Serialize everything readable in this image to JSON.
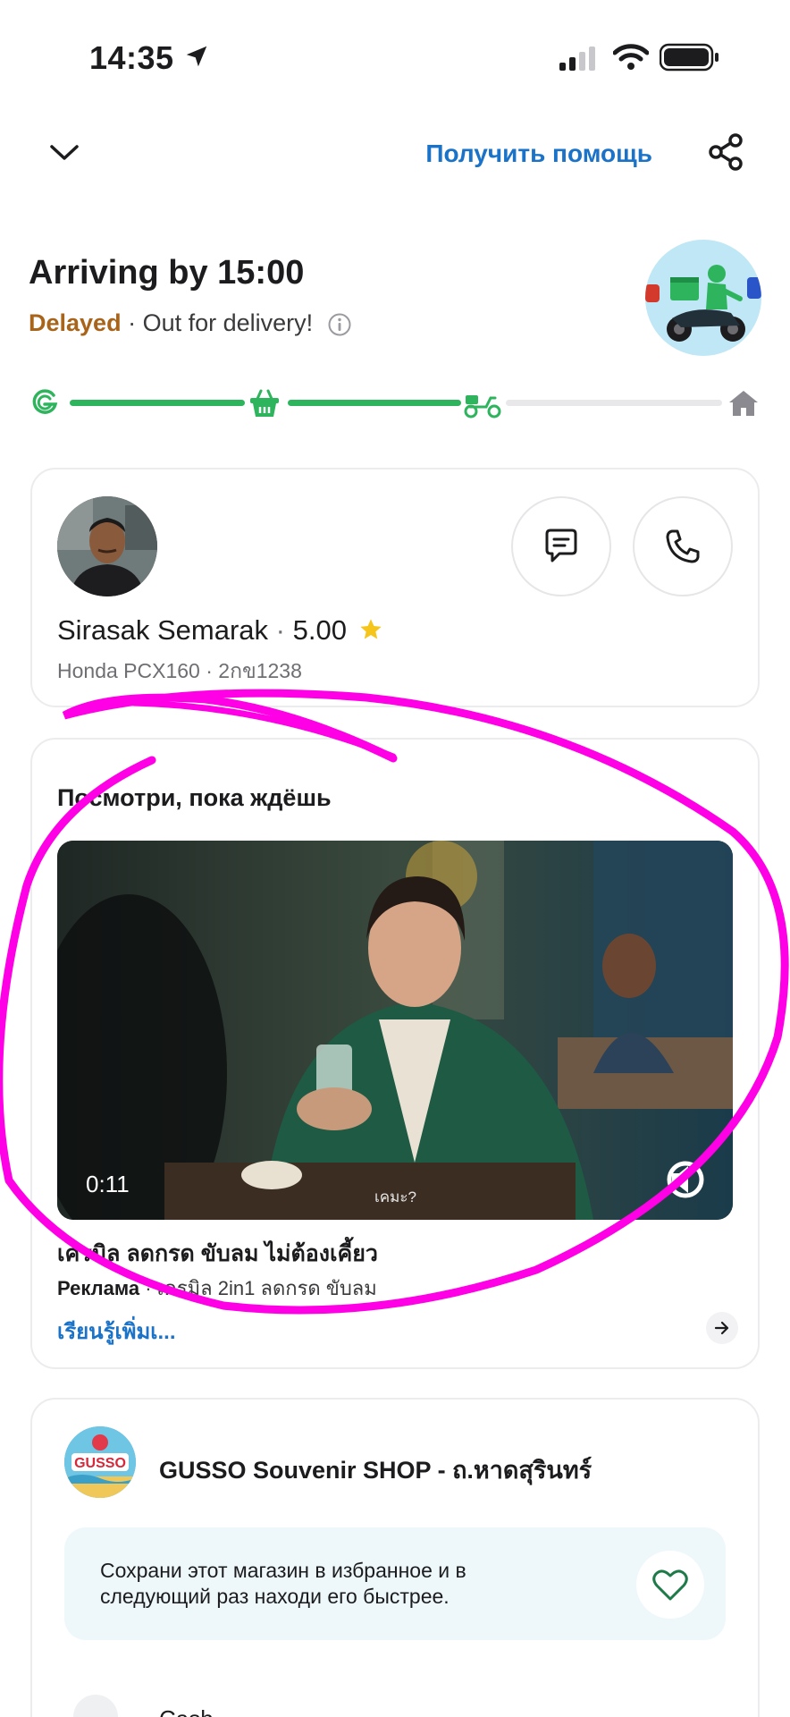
{
  "status_bar": {
    "time": "14:35"
  },
  "nav": {
    "help_label": "Получить помощь"
  },
  "delivery": {
    "arriving": "Arriving by 15:00",
    "delayed": "Delayed",
    "status": "· Out for delivery!",
    "progress_fraction": 0.66
  },
  "driver": {
    "name": "Sirasak Semarak",
    "rating_sep": "·",
    "rating": "5.00",
    "vehicle": "Honda PCX160 · 2กข1238"
  },
  "ad": {
    "heading": "Посмотри, пока ждёшь",
    "video_time": "0:11",
    "video_subtitle": "เคมะ?",
    "title": "เครมิล ลดกรด ขับลม ไม่ต้องเคี้ยว",
    "meta_label": "Реклама",
    "meta_text": " · เครมิล 2in1 ลดกรด ขับลม",
    "link": "เรียนรู้เพิ่มเ..."
  },
  "shop": {
    "name": "GUSSO Souvenir SHOP - ถ.หาดสุรินทร์",
    "logo_text": "GUSSO",
    "fav_text": "Сохрани этот магазин в избранное и в следующий раз находи его быстрее.",
    "payment_label": "Cash"
  },
  "colors": {
    "accent_blue": "#1a73c8",
    "grab_green": "#2fb45e",
    "delayed_brown": "#a8641a",
    "annotation_magenta": "#ff00e6"
  },
  "icons": [
    "location-arrow-icon",
    "signal-icon",
    "wifi-icon",
    "battery-icon",
    "chevron-down-icon",
    "share-icon",
    "info-icon",
    "grab-logo-icon",
    "basket-icon",
    "scooter-icon",
    "home-icon",
    "chat-icon",
    "phone-icon",
    "star-icon",
    "volume-icon",
    "arrow-right-icon",
    "heart-icon",
    "cash-icon"
  ]
}
